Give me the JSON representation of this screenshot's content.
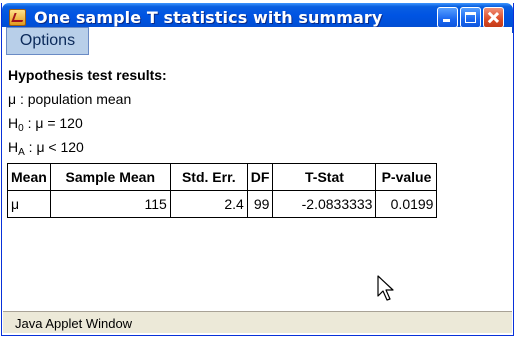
{
  "window": {
    "title": "One sample T statistics with summary",
    "icon": "java-applet-icon",
    "controls": [
      "minimize-icon",
      "maximize-icon",
      "close-icon"
    ]
  },
  "toolbar": {
    "options_label": "Options"
  },
  "results": {
    "heading": "Hypothesis test results:",
    "param_line": "μ : population mean",
    "h0": {
      "h": "H",
      "sub": "0",
      "rest": " : μ = 120"
    },
    "ha": {
      "h": "H",
      "sub": "A",
      "rest": " : μ < 120"
    }
  },
  "table": {
    "headers": [
      "Mean",
      "Sample Mean",
      "Std. Err.",
      "DF",
      "T-Stat",
      "P-value"
    ],
    "rows": [
      [
        "μ",
        "115",
        "2.4",
        "99",
        "-2.0833333",
        "0.0199"
      ]
    ]
  },
  "status": {
    "text": "Java Applet Window"
  },
  "colors": {
    "titlebar": "#0054e3",
    "options_bg": "#b8cfe9",
    "status_bg": "#ece9d8"
  }
}
